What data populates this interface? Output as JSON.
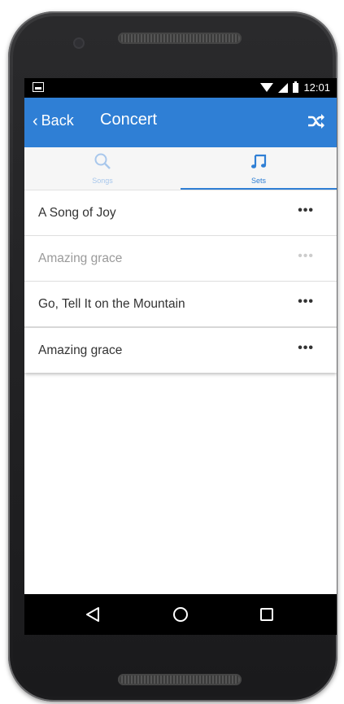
{
  "status": {
    "time": "12:01"
  },
  "appbar": {
    "back_label": "Back",
    "title": "Concert",
    "shuffle_icon": "shuffle-icon"
  },
  "tabs": [
    {
      "label": "Songs",
      "icon": "search-icon",
      "active": false
    },
    {
      "label": "Sets",
      "icon": "music-note-icon",
      "active": true
    }
  ],
  "list": {
    "items": [
      {
        "title": "A Song of Joy",
        "more": "•••"
      },
      {
        "title": "Amazing grace",
        "more": "•••"
      },
      {
        "title": "Go, Tell It on the Mountain",
        "more": "•••"
      },
      {
        "title": "Amazing grace",
        "more": "•••"
      }
    ]
  },
  "colors": {
    "accent": "#2f7fd5",
    "inactive_tab": "#a8c7ec"
  },
  "navbar": {
    "back_icon": "nav-back-icon",
    "home_icon": "nav-home-icon",
    "recents_icon": "nav-recents-icon"
  }
}
